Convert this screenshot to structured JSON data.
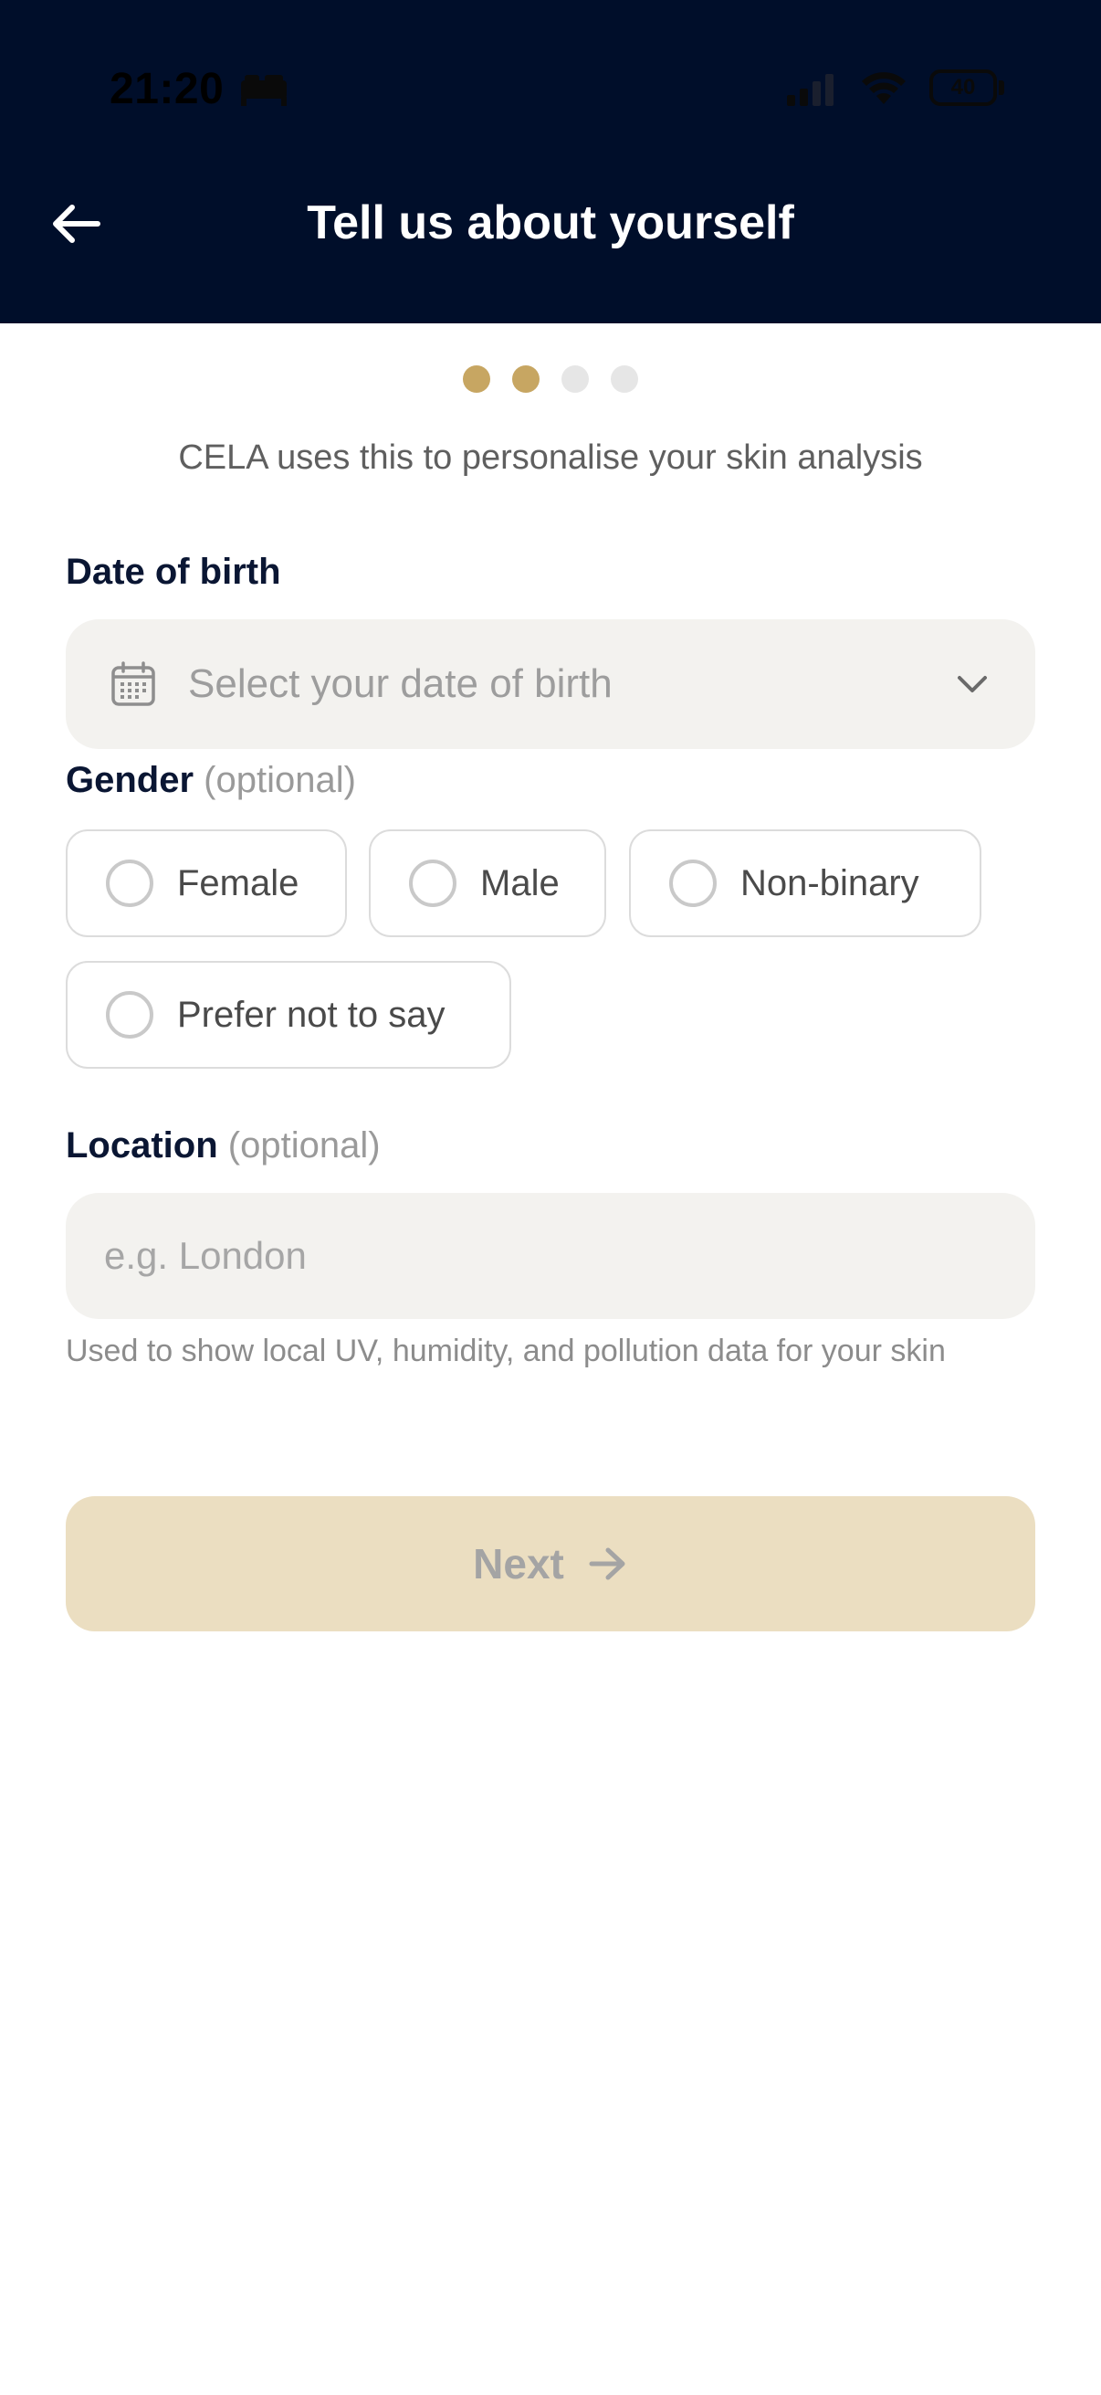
{
  "status_bar": {
    "time": "21:20",
    "battery": "40"
  },
  "header": {
    "title": "Tell us about yourself"
  },
  "progress": {
    "total_steps": 4,
    "current_step": 2,
    "active_color": "#c7a662",
    "inactive_color": "#e6e6e6"
  },
  "intro": {
    "subtitle": "CELA uses this to personalise your skin analysis"
  },
  "dob": {
    "label": "Date of birth",
    "placeholder": "Select your date of birth"
  },
  "gender": {
    "label": "Gender",
    "optional": "(optional)",
    "options": [
      "Female",
      "Male",
      "Non-binary",
      "Prefer not to say"
    ]
  },
  "location": {
    "label": "Location",
    "optional": "(optional)",
    "placeholder": "e.g. London",
    "helper": "Used to show local UV, humidity, and pollution data for your skin"
  },
  "next_button": {
    "label": "Next"
  },
  "colors": {
    "header_bg": "#000e2a",
    "accent": "#c7a662",
    "button_disabled_bg": "#ebdec1"
  }
}
